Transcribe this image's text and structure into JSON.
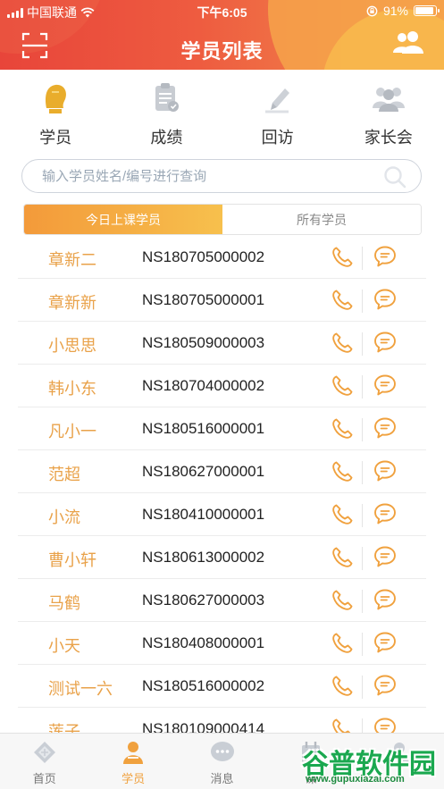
{
  "status_bar": {
    "carrier": "中国联通",
    "time": "下午6:05",
    "battery": "91%",
    "battery_level": 0.91
  },
  "header": {
    "title": "学员列表",
    "left_icon": "scan-icon",
    "right_icon": "group-icon"
  },
  "categories": [
    {
      "label": "学员",
      "icon": "student-icon"
    },
    {
      "label": "成绩",
      "icon": "grades-icon"
    },
    {
      "label": "回访",
      "icon": "follow-up-icon"
    },
    {
      "label": "家长会",
      "icon": "parents-meeting-icon"
    }
  ],
  "search": {
    "placeholder": "输入学员姓名/编号进行查询"
  },
  "tabs": [
    {
      "label": "今日上课学员",
      "active": true
    },
    {
      "label": "所有学员",
      "active": false
    }
  ],
  "students": [
    {
      "name": "章新二",
      "id": "NS180705000002"
    },
    {
      "name": "章新新",
      "id": "NS180705000001"
    },
    {
      "name": "小思思",
      "id": "NS180509000003"
    },
    {
      "name": "韩小东",
      "id": "NS180704000002"
    },
    {
      "name": "凡小一",
      "id": "NS180516000001"
    },
    {
      "name": "范超",
      "id": "NS180627000001"
    },
    {
      "name": "小流",
      "id": "NS180410000001"
    },
    {
      "name": "曹小轩",
      "id": "NS180613000002"
    },
    {
      "name": "马鹤",
      "id": "NS180627000003"
    },
    {
      "name": "小天",
      "id": "NS180408000001"
    },
    {
      "name": "测试一六",
      "id": "NS180516000002"
    },
    {
      "name": "莲子",
      "id": "NS180109000414"
    }
  ],
  "bottom_nav": [
    {
      "label": "首页",
      "icon": "home-icon",
      "active": false
    },
    {
      "label": "学员",
      "icon": "student-icon",
      "active": true
    },
    {
      "label": "消息",
      "icon": "message-icon",
      "active": false
    },
    {
      "label": "课",
      "icon": "course-icon",
      "active": false
    },
    {
      "label": "",
      "icon": "profile-icon",
      "active": false
    }
  ],
  "watermark": {
    "logo": "谷普软件园",
    "url": "www.gupuxiazai.com"
  },
  "colors": {
    "accent": "#f0a13e",
    "name_text": "#e9a24a",
    "header_start": "#e8453a",
    "header_end": "#f39a4c",
    "watermark": "#1aa84f"
  }
}
